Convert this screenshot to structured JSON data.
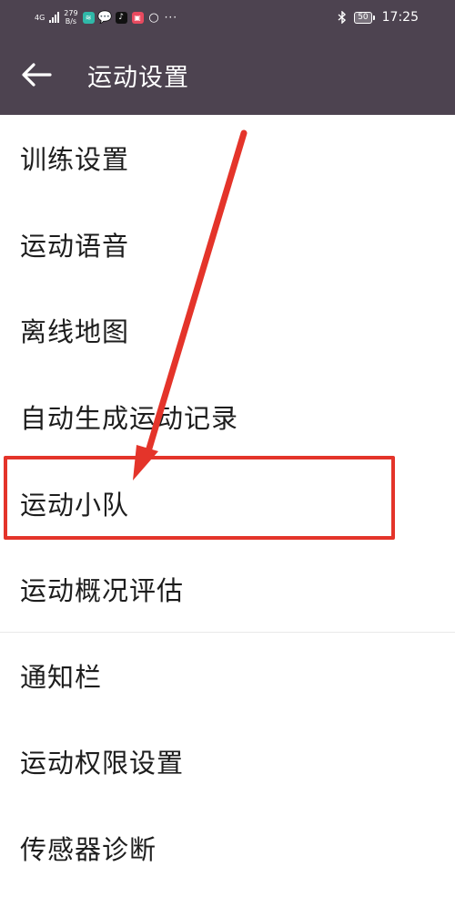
{
  "status_bar": {
    "network_type": "4G",
    "net_speed_value": "279",
    "net_speed_unit": "B/s",
    "time": "17:25",
    "battery": "50",
    "more": "···",
    "icons": [
      "signal-icon",
      "wifi-app-icon",
      "chat-icon",
      "tiktok-icon",
      "mail-icon",
      "ring-icon"
    ]
  },
  "header": {
    "title": "运动设置",
    "back_icon": "back-arrow-icon"
  },
  "settings": {
    "items": [
      {
        "label": "训练设置"
      },
      {
        "label": "运动语音"
      },
      {
        "label": "离线地图"
      },
      {
        "label": "自动生成运动记录"
      },
      {
        "label": "运动小队"
      },
      {
        "label": "运动概况评估"
      },
      {
        "label": "通知栏"
      },
      {
        "label": "运动权限设置"
      },
      {
        "label": "传感器诊断"
      }
    ]
  },
  "annotation": {
    "color": "#e4342a",
    "highlighted_item": "运动小队"
  },
  "colors": {
    "header_bg": "#4d4350",
    "text": "#1d1d1d",
    "background": "#ffffff"
  }
}
